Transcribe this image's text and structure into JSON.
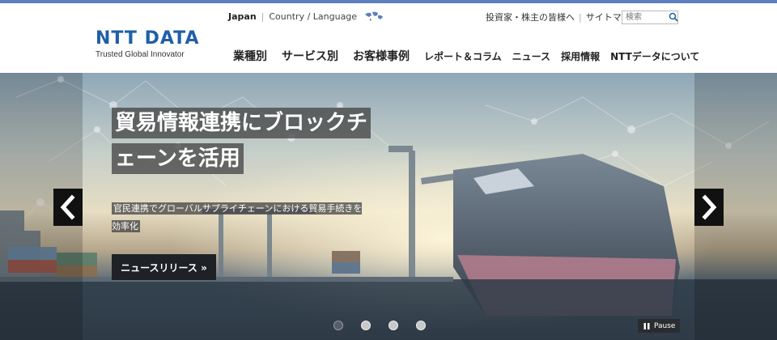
{
  "header": {
    "logo_main": "NTT DATA",
    "logo_sub": "Trusted Global Innovator",
    "lang_current": "Japan",
    "lang_switch": "Country / Language",
    "util_links": [
      "投資家・株主の皆様へ",
      "サイトマップ"
    ],
    "search_placeholder": "検索"
  },
  "nav": {
    "items": [
      "業種別",
      "サービス別",
      "お客様事例",
      "レポート＆コラム",
      "ニュース",
      "採用情報",
      "NTTデータについて"
    ]
  },
  "hero": {
    "headline_line1": "貿易情報連携にブロックチ",
    "headline_line2": "ェーンを活用",
    "subtext": "官民連携でグローバルサプライチェーンにおける貿易手続きを効率化",
    "cta_label": "ニュースリリース »",
    "pause_label": "Pause",
    "slide_count": 4,
    "active_slide": 1
  },
  "icons": {
    "globe": "globe-icon",
    "search": "search-icon",
    "prev": "chevron-left-icon",
    "next": "chevron-right-icon",
    "pause": "pause-icon"
  },
  "colors": {
    "brand_blue": "#1f5fa8",
    "top_bar": "#5b7fbf",
    "dark_button": "#1e2226"
  }
}
